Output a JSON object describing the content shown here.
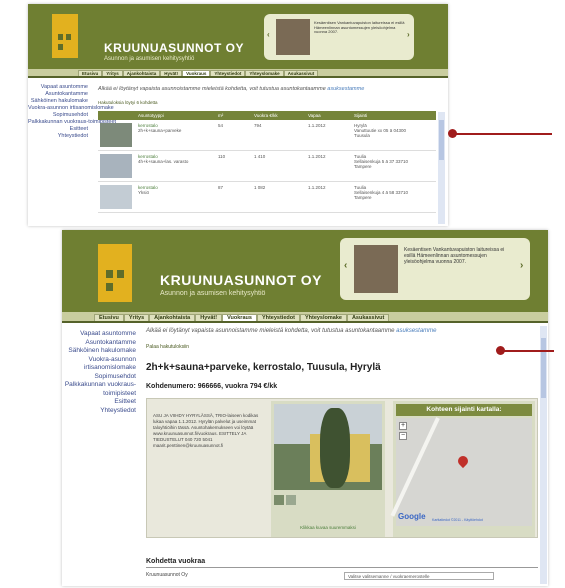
{
  "site": {
    "brand": "KRUUNUASUNNOT OY",
    "tagline": "Asunnon ja asumisen kehitysyhtiö"
  },
  "promo": {
    "shot1_text": "Kesäentisen Vankantuvapuiston laitureissa ei esillä Hämeenlinnan asuntomessujen yleisöohjelma vuonna 2007.",
    "shot2_text": "Kesäentisen Vankantuvapuiston laitureissa ei esillä Hämeenlinnan asuntomessujen yleisöohjelma vuonna 2007."
  },
  "nav": [
    "Etusivu",
    "Yritys",
    "Ajankohtaista",
    "Hyvät!",
    "Vuokraus",
    "Yhteystiedot",
    "Yhteyslomake",
    "Asukassivut"
  ],
  "nav_active_index": 4,
  "sidebar": [
    "Vapaat asuntomme",
    "Asuntokantamme",
    "Sähköinen hakulomake",
    "Vuokra-asunnon irtisanomislomake",
    "Sopimusehdot",
    "Palkkakunnan vuokraus-toimipisteet",
    "Esitteet",
    "Yhteystiedot"
  ],
  "intro": {
    "text": "Alkää ei löytänyt vapaista asunnoistamme mieleistä kohdetta, voit tutustua asuntokantaamme ",
    "link": "asuksestamme"
  },
  "list": {
    "count_text": "Hakutuloksia löytyi 6 kohdetta",
    "columns": [
      "",
      "Asuntotyyppi",
      "m²",
      "Vuokra €/kk",
      "Vapaa",
      "Sijainti"
    ],
    "rows": [
      {
        "type": "kerrostalo",
        "desc": "2h+k+sauna+parveke",
        "m2": "54",
        "rent": "794",
        "free": "1.1.2012",
        "loc": "Hyrylä",
        "addr": "Vanuttuutie xx 05 ä 04300 Tuusula"
      },
      {
        "type": "kerrostalo",
        "desc": "4h+k+sauna+las. varasto",
        "m2": "110",
        "rent": "1 410",
        "free": "1.1.2012",
        "loc": "Tuulia",
        "addr": "Sellaisenkuja 5 ä 37 33710 Tampere"
      },
      {
        "type": "kerrostalo",
        "desc": "Yksiö",
        "m2": "87",
        "rent": "1 082",
        "free": "1.1.2012",
        "loc": "Tuulia",
        "addr": "Sellaisenkuja 4 ä 58 33710 Tampere"
      }
    ]
  },
  "detail": {
    "breadcrumb": "Palaa hakutuloksiin",
    "title": "2h+k+sauna+parveke, kerrostalo, Tuusula, Hyrylä",
    "code": "Kohdenumero: 966666, vuokra 794 €/kk",
    "description": "ASU JA VIIHDY HYRYLÄSSÄ, TRIO-laiseen kodikas lukaa vapaa 1.1.2012. Hyrylän palvelut ja useimmat taloyhtiöihin tässä. Asuntohakemukseen voi löytää www.kruunuasunnot.fi/vuokraus. ESITTELY JA TIEDUSTELUT 040 720 5041 maarit.penttinen@kruunuasunnot.fi",
    "photo_caption": "Klikkaa kuvaa suuremmaksi",
    "map_title": "Kohteen sijainti kartalla:",
    "map_logo": "Google",
    "map_footer": "Karttatiedot ©2011 - Käyttöehdot",
    "form_title": "Kohdetta vuokraa",
    "landlord": "Kruunuasunnot Oy",
    "select_placeholder": "Valitse valitsemanne / vuokraemerostelle"
  },
  "colors": {
    "header_green": "#6f7f32",
    "nav_bar": "#c9cd9f",
    "logo_yellow": "#e2b11f",
    "link_blue": "#4a7dbb",
    "callout_red": "#a01c1c"
  }
}
